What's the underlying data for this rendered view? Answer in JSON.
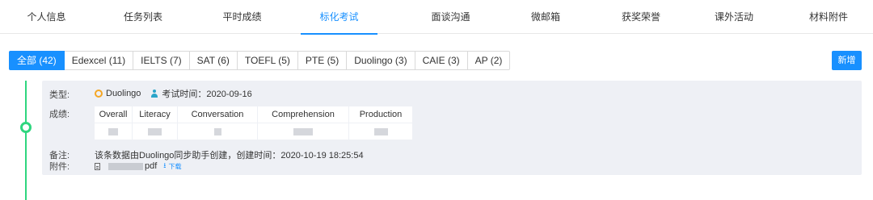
{
  "tabs": [
    {
      "label": "个人信息"
    },
    {
      "label": "任务列表"
    },
    {
      "label": "平时成绩"
    },
    {
      "label": "标化考试"
    },
    {
      "label": "面谈沟通"
    },
    {
      "label": "微邮箱"
    },
    {
      "label": "获奖荣誉"
    },
    {
      "label": "课外活动"
    },
    {
      "label": "材料附件"
    }
  ],
  "active_tab": "标化考试",
  "filters": [
    {
      "label": "全部 (42)"
    },
    {
      "label": "Edexcel (11)"
    },
    {
      "label": "IELTS (7)"
    },
    {
      "label": "SAT (6)"
    },
    {
      "label": "TOEFL (5)"
    },
    {
      "label": "PTE (5)"
    },
    {
      "label": "Duolingo (3)"
    },
    {
      "label": "CAIE (3)"
    },
    {
      "label": "AP (2)"
    }
  ],
  "active_filter": "全部 (42)",
  "add_button": "新增",
  "record": {
    "type_label": "类型:",
    "type_value": "Duolingo",
    "exam_time": "考试时间：2020-09-16",
    "score_label": "成绩:",
    "score_headers": [
      "Overall",
      "Literacy",
      "Conversation",
      "Comprehension",
      "Production"
    ],
    "remark_label": "备注:",
    "remark": "该条数据由Duolingo同步助手创建，创建时间：2020-10-19 18:25:54",
    "attachment_label": "附件:",
    "attachment_ext": "pdf",
    "download": "下载"
  },
  "colors": {
    "accent": "#1890ff",
    "timeline": "#2fd67f",
    "card_bg": "#eef0f5",
    "duolingo_icon": "#f5a623"
  },
  "icons": {
    "type": "coin-icon",
    "person": "person-icon",
    "file": "file-icon",
    "download": "download-icon"
  }
}
